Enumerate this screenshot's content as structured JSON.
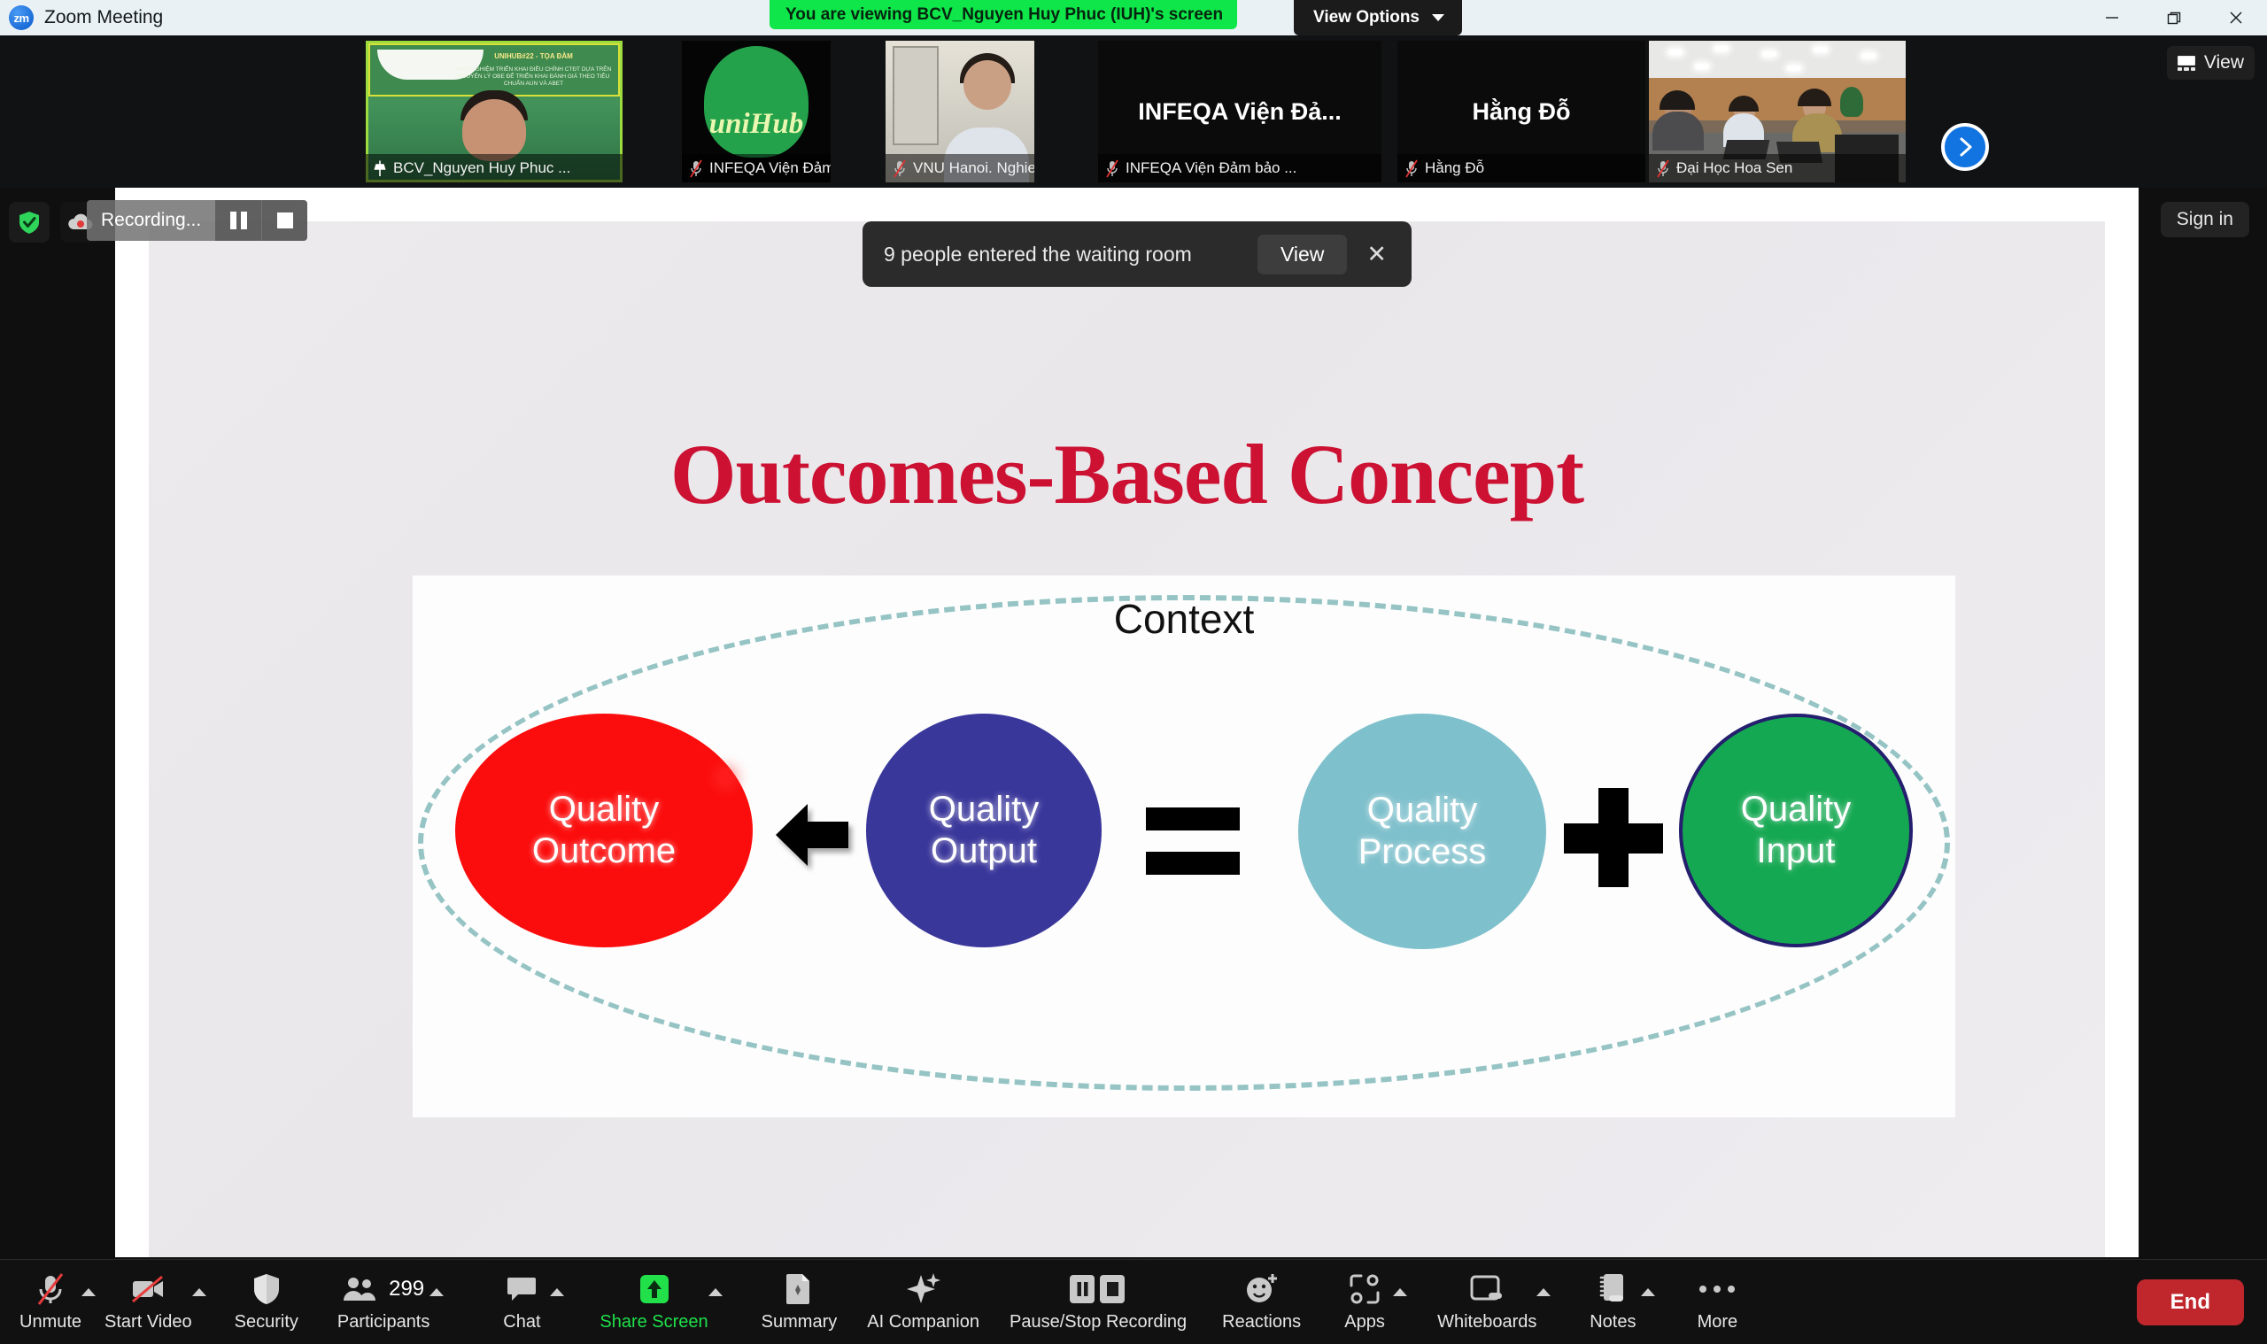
{
  "window": {
    "app_title": "Zoom Meeting",
    "logo_text": "zm",
    "minimize_icon": "minimize-icon",
    "restore_icon": "restore-window-icon",
    "close_icon": "close-icon"
  },
  "share_banner": {
    "text": "You are viewing BCV_Nguyen Huy Phuc (IUH)'s screen",
    "view_options_label": "View Options",
    "banner_color": "#0fe649"
  },
  "filmstrip": {
    "view_button_label": "View",
    "next_arrow_icon": "chevron-right-icon",
    "thumbnails": [
      {
        "name": "BCV_Nguyen Huy Phuc ...",
        "status_icon": "pin-icon",
        "active": true,
        "slide_title": "UNIHUB#22 - TỌA ĐÀM",
        "slide_sub": "KINH NGHIỆM TRIỂN KHAI ĐIỀU CHỈNH CTĐT DỰA TRÊN NGUYÊN LÝ OBE ĐỂ TRIỂN KHAI ĐÁNH GIÁ THEO TIÊU CHUẨN AUN VÀ ABET"
      },
      {
        "name": "INFEQA Viện Đảm bảo ...",
        "status_icon": "mic-off-icon",
        "active": false,
        "logo_text": "uniHub"
      },
      {
        "name": "VNU Hanoi. Nghiem Xu...",
        "status_icon": "mic-off-icon",
        "active": false
      },
      {
        "name": "INFEQA Viện Đảm bảo ...",
        "status_icon": "mic-off-icon",
        "active": false,
        "display_text": "INFEQA Viện Đả..."
      },
      {
        "name": "Hằng Đỗ",
        "status_icon": "mic-off-icon",
        "active": false,
        "display_text": "Hằng Đỗ"
      },
      {
        "name": "Đại Học Hoa Sen",
        "status_icon": "mic-off-icon",
        "active": false
      }
    ]
  },
  "recording_pill": {
    "label": "Recording...",
    "pause_icon": "pause-icon",
    "stop_icon": "stop-icon"
  },
  "left_rail": [
    {
      "icon": "shield-check-icon",
      "color": "#2fd45a"
    },
    {
      "icon": "cloud-record-icon",
      "color": "#e03a3a"
    }
  ],
  "toast": {
    "message": "9 people entered the waiting room",
    "view_label": "View",
    "close_icon": "close-icon"
  },
  "sign_in": {
    "label": "Sign in"
  },
  "slide": {
    "title": "Outcomes-Based Concept",
    "title_color": "#cc1133",
    "context_label": "Context",
    "circles": [
      {
        "id": "quality-outcome",
        "line1": "Quality",
        "line2": "Outcome",
        "color": "#fc0d0d"
      },
      {
        "id": "quality-output",
        "line1": "Quality",
        "line2": "Output",
        "color": "#3a379b"
      },
      {
        "id": "quality-process",
        "line1": "Quality",
        "line2": "Process",
        "color": "#7ec0cc"
      },
      {
        "id": "quality-input",
        "line1": "Quality",
        "line2": "Input",
        "color": "#15a852"
      }
    ],
    "operators": [
      {
        "id": "arrow-left",
        "symbol": "arrow"
      },
      {
        "id": "equals",
        "symbol": "="
      },
      {
        "id": "plus",
        "symbol": "+"
      }
    ],
    "laser_pointer": {
      "visible": true,
      "color": "#ff1b1b"
    },
    "ellipse_color": "#96c4c4"
  },
  "toolbar": {
    "items": [
      {
        "id": "unmute",
        "label": "Unmute",
        "icon": "microphone-off-icon",
        "chevron": true
      },
      {
        "id": "start-video",
        "label": "Start Video",
        "icon": "camera-off-icon",
        "chevron": true
      },
      {
        "id": "security",
        "label": "Security",
        "icon": "shield-icon",
        "chevron": false
      },
      {
        "id": "participants",
        "label": "Participants",
        "icon": "people-icon",
        "chevron": true,
        "count": "299"
      },
      {
        "id": "chat",
        "label": "Chat",
        "icon": "chat-bubble-icon",
        "chevron": true
      },
      {
        "id": "share-screen",
        "label": "Share Screen",
        "icon": "share-screen-icon",
        "chevron": true,
        "active": true
      },
      {
        "id": "summary",
        "label": "Summary",
        "icon": "summary-doc-icon",
        "chevron": false
      },
      {
        "id": "ai-companion",
        "label": "AI Companion",
        "icon": "sparkle-icon",
        "chevron": false
      },
      {
        "id": "recording",
        "label": "Pause/Stop Recording",
        "icon": "pause-stop-icon",
        "chevron": false
      },
      {
        "id": "reactions",
        "label": "Reactions",
        "icon": "smiley-plus-icon",
        "chevron": false
      },
      {
        "id": "apps",
        "label": "Apps",
        "icon": "apps-icon",
        "chevron": true
      },
      {
        "id": "whiteboards",
        "label": "Whiteboards",
        "icon": "whiteboard-icon",
        "chevron": true
      },
      {
        "id": "notes",
        "label": "Notes",
        "icon": "notes-icon",
        "chevron": true
      },
      {
        "id": "more",
        "label": "More",
        "icon": "ellipsis-icon",
        "chevron": false
      }
    ],
    "end_button": {
      "label": "End",
      "color": "#c0272d"
    }
  }
}
